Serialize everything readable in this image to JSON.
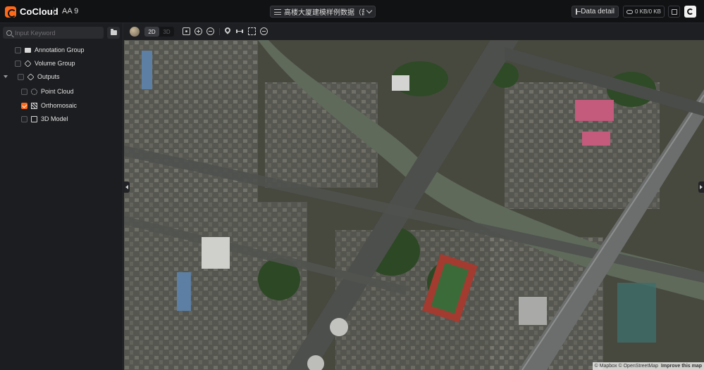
{
  "app": {
    "brand": "CoCloud",
    "project_name": "AA 9",
    "dataset_title": "高楼大厦建模样例数据（部..."
  },
  "header": {
    "data_detail_label": "Data detail",
    "transfer_speed": "0 KB/0 KB"
  },
  "sidebar": {
    "search_placeholder": "Input Keyword",
    "items": [
      {
        "label": "Annotation Group",
        "icon": "folder-icon",
        "checked": false
      },
      {
        "label": "Volume Group",
        "icon": "cube-icon",
        "checked": false
      },
      {
        "label": "Outputs",
        "icon": "cube-icon",
        "checked": false,
        "expanded": true
      },
      {
        "label": "Point Cloud",
        "icon": "point-cloud-icon",
        "checked": false
      },
      {
        "label": "Orthomosaic",
        "icon": "orthomosaic-icon",
        "checked": true
      },
      {
        "label": "3D Model",
        "icon": "model-icon",
        "checked": false
      }
    ]
  },
  "toolbar": {
    "mode_2d": "2D",
    "mode_3d": "3D",
    "active_mode": "2D"
  },
  "map": {
    "attribution": "© Mapbox © OpenStreetMap",
    "improve_label": "Improve this map"
  },
  "colors": {
    "accent": "#ff6a1a",
    "header_bg": "#111214",
    "sidebar_bg": "#1c1d20"
  }
}
